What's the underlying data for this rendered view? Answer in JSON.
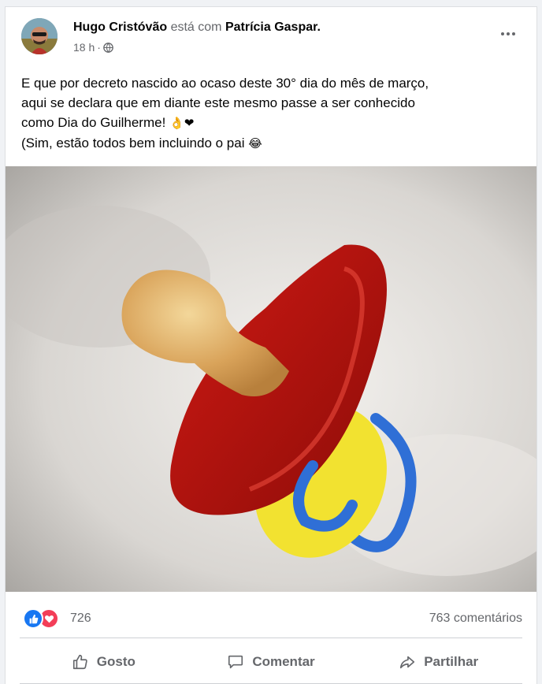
{
  "post": {
    "author": "Hugo Cristóvão",
    "with_text": "está com",
    "tagged": "Patrícia Gaspar.",
    "time": "18 h",
    "separator": "·",
    "text_lines": [
      "E que por decreto nascido ao ocaso deste 30° dia do mês de março,",
      "aqui se declara que em diante este mesmo passe a ser conhecido",
      "como Dia do Guilherme!",
      "(Sim, estão todos bem incluindo o pai"
    ],
    "emoji_line3": "👌❤",
    "emoji_line4": "😂"
  },
  "stats": {
    "reaction_count": "726",
    "comments": "763 comentários"
  },
  "actions": {
    "like": "Gosto",
    "comment": "Comentar",
    "share": "Partilhar"
  },
  "colors": {
    "like_blue": "#1877f2",
    "love_red": "#f33e58",
    "secondary_text": "#65676b"
  }
}
